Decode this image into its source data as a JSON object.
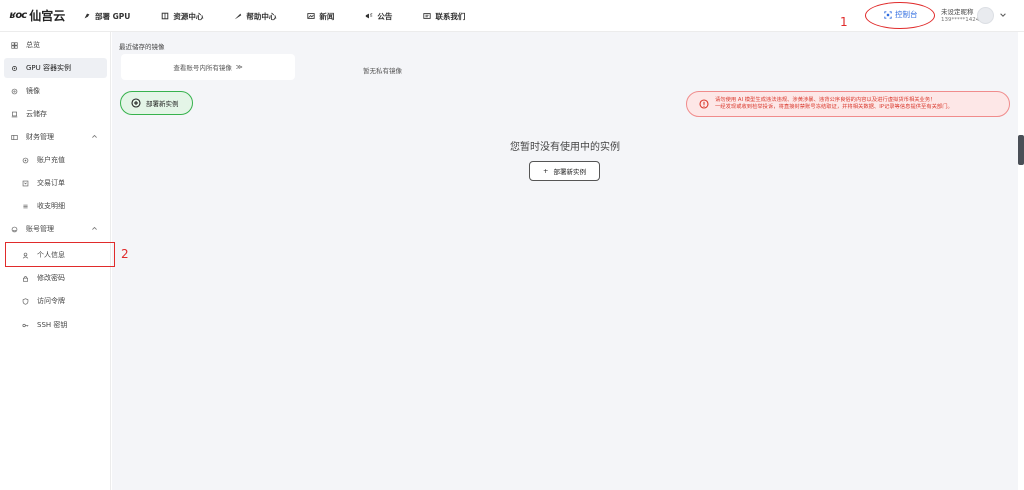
{
  "header": {
    "logo_mark": "ʁoc",
    "logo_text": "仙宫云",
    "nav": [
      {
        "label": "部署 GPU",
        "icon": "rocket-icon"
      },
      {
        "label": "资源中心",
        "icon": "book-icon"
      },
      {
        "label": "帮助中心",
        "icon": "feather-icon"
      },
      {
        "label": "新闻",
        "icon": "image-icon"
      },
      {
        "label": "公告",
        "icon": "megaphone-icon"
      },
      {
        "label": "联系我们",
        "icon": "card-icon"
      }
    ],
    "console_label": "控制台",
    "user_name": "未设定昵称",
    "user_phone": "139*****1424"
  },
  "annotations": {
    "num1": "1",
    "num2": "2",
    "color": "#e02b2b"
  },
  "sidebar": {
    "items": [
      {
        "label": "总览",
        "icon": "overview-icon"
      },
      {
        "label": "GPU 容器实例",
        "icon": "gear-icon"
      },
      {
        "label": "镜像",
        "icon": "disc-icon"
      },
      {
        "label": "云储存",
        "icon": "storage-icon"
      },
      {
        "label": "财务管理",
        "icon": "finance-icon"
      },
      {
        "label": "账户充值",
        "icon": "recharge-icon"
      },
      {
        "label": "交易订单",
        "icon": "order-icon"
      },
      {
        "label": "收支明细",
        "icon": "list-icon"
      },
      {
        "label": "账号管理",
        "icon": "account-icon"
      },
      {
        "label": "个人信息",
        "icon": "user-icon"
      },
      {
        "label": "修改密码",
        "icon": "lock-icon"
      },
      {
        "label": "访问令牌",
        "icon": "shield-icon"
      },
      {
        "label": "SSH 密钥",
        "icon": "key-icon"
      }
    ]
  },
  "main": {
    "recent_title": "最近储存的镜像",
    "view_all": "查看账号内所有镜像",
    "view_all_arrow": "≫",
    "no_private": "暂无私有镜像",
    "deploy_label": "部署新实例",
    "warning_line1": "请勿使用 AI 模型生成违法违规、涉黄涉暴、违背公序良俗的内容以及进行虚拟货币相关业务！",
    "warning_line2": "一经发现或收到检举投诉，将直接封禁账号冻结取证，并将相关数据、IP记录等信息提供至有关部门。",
    "empty_text": "您暂时没有使用中的实例",
    "deploy_outline_label": "部署新实例",
    "plus": "+"
  },
  "colors": {
    "accent": "#2f6ce0",
    "green": "#37b24d",
    "warning_red": "#d9372b"
  }
}
